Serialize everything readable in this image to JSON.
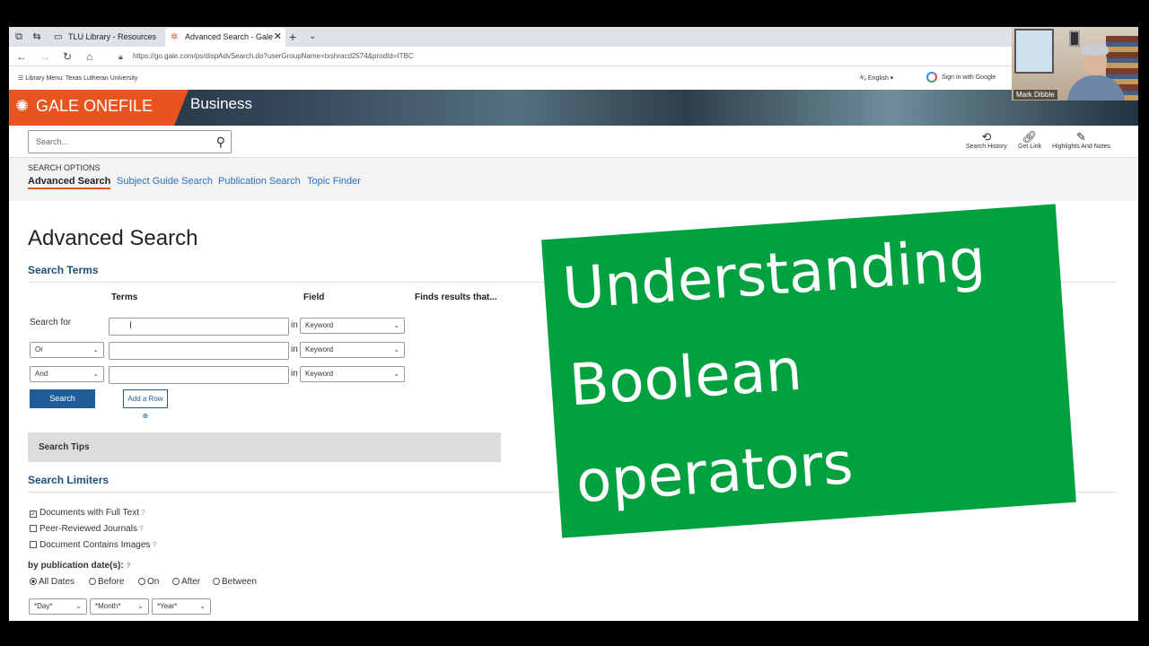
{
  "browser": {
    "tabs": [
      {
        "label": "TLU Library - Resources"
      },
      {
        "label": "Advanced Search - Gale"
      }
    ],
    "url": "https://go.gale.com/ps/dispAdvSearch.do?userGroupName=txshracd2574&prodId=ITBC"
  },
  "library_menu": {
    "label": "Library Menu: Texas Lutheran University",
    "language": "English",
    "sign_in": "Sign in with Google"
  },
  "banner": {
    "brand": "GALE ONEFILE",
    "product": "Business"
  },
  "search": {
    "placeholder": "Search..."
  },
  "tools": {
    "history": "Search History",
    "get_link": "Get Link",
    "highlights": "Highlights And Notes"
  },
  "search_options": {
    "label": "SEARCH OPTIONS",
    "links": [
      "Advanced Search",
      "Subject Guide Search",
      "Publication Search",
      "Topic Finder"
    ]
  },
  "main": {
    "title": "Advanced Search",
    "search_terms_heading": "Search Terms",
    "col_terms": "Terms",
    "col_field": "Field",
    "col_finds": "Finds results that...",
    "search_for": "Search for",
    "in_label": "in",
    "rows": [
      {
        "operator": "",
        "field": "Keyword"
      },
      {
        "operator": "Or",
        "field": "Keyword"
      },
      {
        "operator": "And",
        "field": "Keyword"
      }
    ],
    "search_button": "Search",
    "add_row_button": "Add a Row",
    "search_tips": "Search Tips",
    "limiters_heading": "Search Limiters",
    "checks": [
      {
        "label": "Documents with Full Text",
        "checked": true
      },
      {
        "label": "Peer-Reviewed Journals",
        "checked": false
      },
      {
        "label": "Document Contains Images",
        "checked": false
      }
    ],
    "pub_date_label": "by publication date(s):",
    "date_options": [
      {
        "label": "All Dates",
        "selected": true
      },
      {
        "label": "Before",
        "selected": false
      },
      {
        "label": "On",
        "selected": false
      },
      {
        "label": "After",
        "selected": false
      },
      {
        "label": "Between",
        "selected": false
      }
    ],
    "date_selects": [
      "*Day*",
      "*Month*",
      "*Year*"
    ]
  },
  "overlay": {
    "line1": "Understanding",
    "line2": "Boolean",
    "line3": "operators"
  },
  "webcam": {
    "name": "Mark Dibble"
  }
}
